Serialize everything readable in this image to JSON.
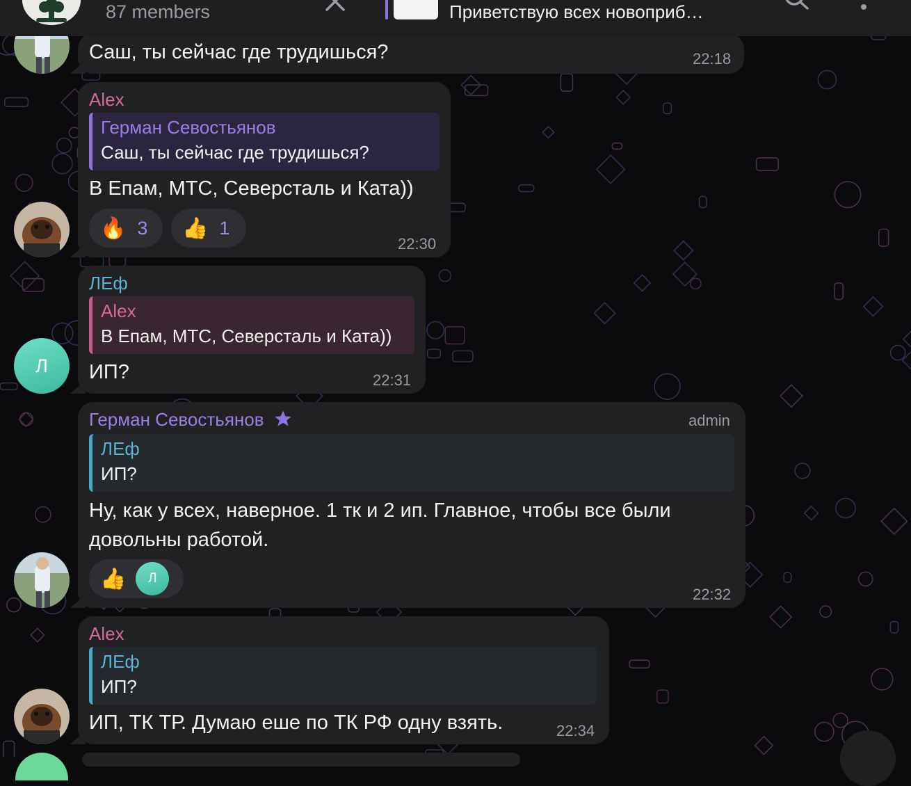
{
  "header": {
    "members": "87 members",
    "pinned_message": "Приветствую всех новоприб…",
    "icons": [
      "chat-avatar",
      "close-icon",
      "search-icon",
      "more-vertical-icon"
    ]
  },
  "messages": [
    {
      "id": "m1",
      "sender": "",
      "text": "Саш, ты сейчас где трудишься?",
      "time": "22:18"
    },
    {
      "id": "m2",
      "sender": "Alex",
      "sender_color": "#d46a9a",
      "reply_to": {
        "name": "Герман Севостьянов",
        "text": "Саш, ты сейчас где трудишься?"
      },
      "text": "В Епам, МТС, Северсталь и Ката))",
      "reactions": [
        {
          "emoji": "🔥",
          "icon": "fire-emoji",
          "count": "3"
        },
        {
          "emoji": "👍",
          "icon": "thumbs-up-emoji",
          "count": "1"
        }
      ],
      "time": "22:30"
    },
    {
      "id": "m3",
      "sender": "ЛЕф",
      "sender_color": "#5cb2d4",
      "avatar_letter": "Л",
      "reply_to": {
        "name": "Alex",
        "text": "В Епам, МТС, Северсталь и Ката))"
      },
      "text": "ИП?",
      "time": "22:31"
    },
    {
      "id": "m4",
      "sender": "Герман Севостьянов",
      "sender_color": "#9c7fe6",
      "badge": "admin",
      "reply_to": {
        "name": "ЛЕф",
        "text": "ИП?"
      },
      "text_lines": [
        "Ну, как у всех, наверное. 1 тк и 2 ип. Главное, чтобы все были",
        "довольны работой."
      ],
      "reactions": [
        {
          "emoji": "👍",
          "icon": "thumbs-up-emoji",
          "reactor_letter": "Л"
        }
      ],
      "time": "22:32"
    },
    {
      "id": "m5",
      "sender": "Alex",
      "sender_color": "#d46a9a",
      "reply_to": {
        "name": "ЛЕф",
        "text": "ИП?"
      },
      "text": "ИП, ТК ТР. Думаю еше по ТК РФ одну взять.",
      "time": "22:34"
    }
  ],
  "colors": {
    "background": "#0b0b0d",
    "bubble": "#212124",
    "header": "#1f1f22",
    "accent": "#8f74e0"
  }
}
